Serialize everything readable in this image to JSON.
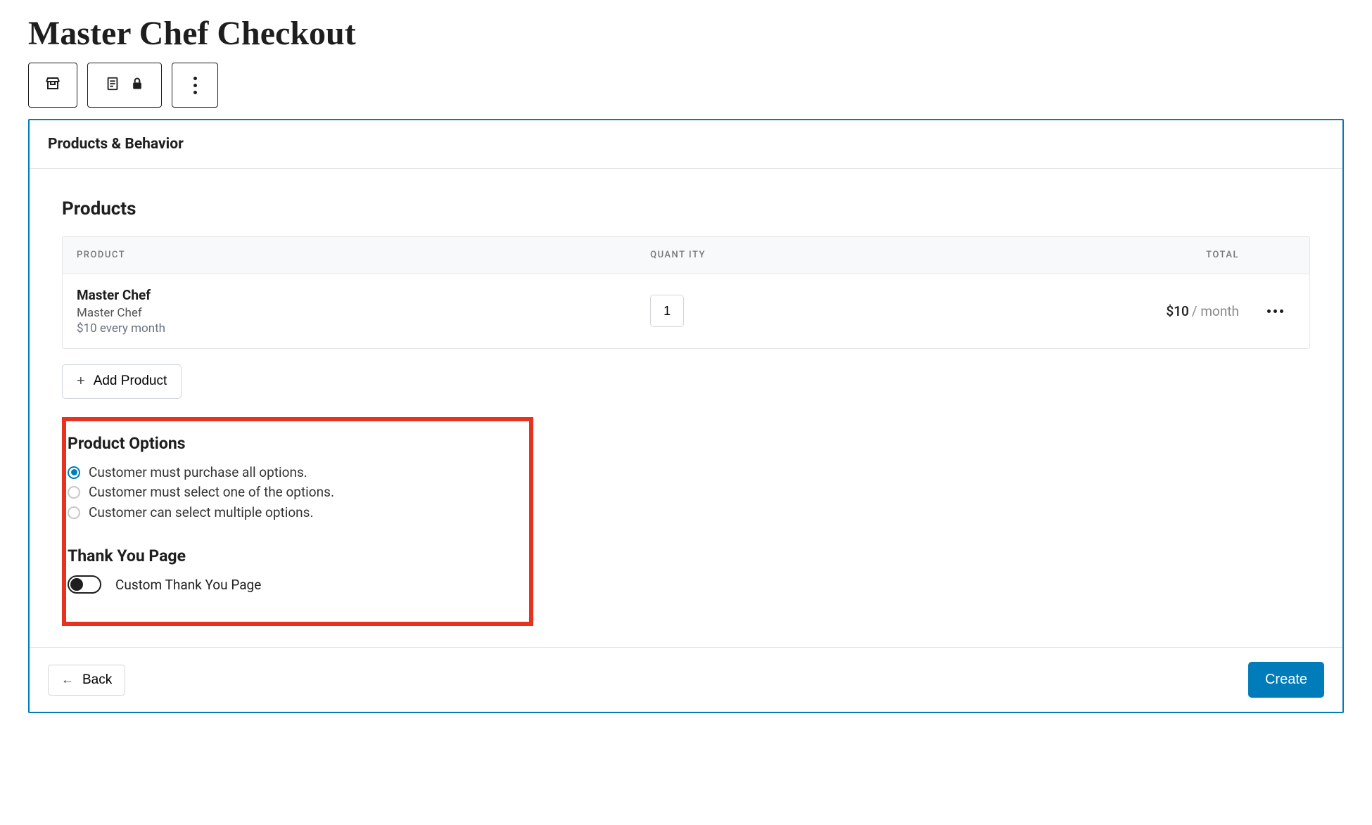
{
  "page": {
    "title": "Master Chef Checkout"
  },
  "panel": {
    "header": "Products & Behavior"
  },
  "products": {
    "heading": "Products",
    "columns": {
      "product": "PRODUCT",
      "quantity": "QUANT ITY",
      "total": "TOTAL"
    },
    "rows": [
      {
        "name": "Master Chef",
        "subtitle": "Master Chef",
        "price_note": "$10 every month",
        "quantity": "1",
        "total_amount": "$10",
        "total_period": "/ month"
      }
    ],
    "add_label": "Add Product"
  },
  "product_options": {
    "heading": "Product Options",
    "options": [
      {
        "label": "Customer must purchase all options.",
        "selected": true
      },
      {
        "label": "Customer must select one of the options.",
        "selected": false
      },
      {
        "label": "Customer can select multiple options.",
        "selected": false
      }
    ]
  },
  "thank_you": {
    "heading": "Thank You Page",
    "toggle_label": "Custom Thank You Page",
    "toggle_on": false
  },
  "footer": {
    "back": "Back",
    "create": "Create"
  }
}
